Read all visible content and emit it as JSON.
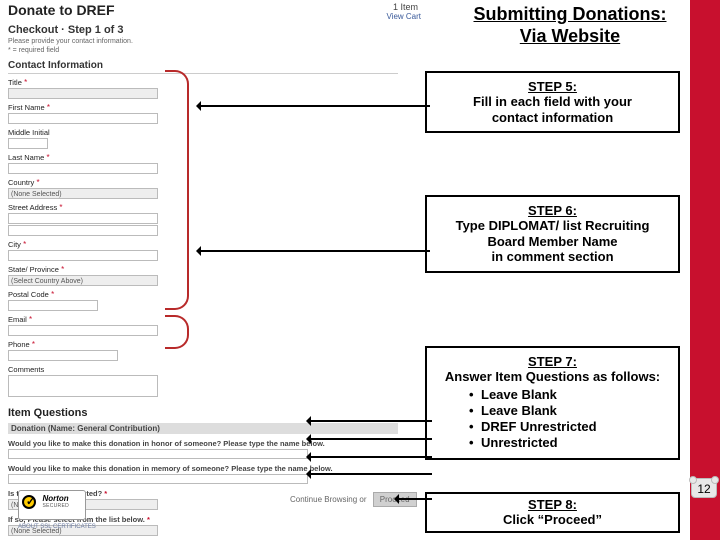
{
  "slide": {
    "title_l1": "Submitting Donations:",
    "title_l2": "Via Website",
    "page_number": "12"
  },
  "checkout": {
    "header": "Donate to DREF",
    "item_count": "1 Item",
    "view_cart": "View Cart",
    "step_line": "Checkout · Step 1 of 3",
    "step_note": "Please provide your contact information.",
    "req_note": "* = required field",
    "section_header": "Contact Information",
    "fields": {
      "title": "Title",
      "title_value": "",
      "first_name": "First Name",
      "middle_initial": "Middle Initial",
      "last_name": "Last Name",
      "country": "Country",
      "country_value": "(None Selected)",
      "street_address": "Street Address",
      "city": "City",
      "state": "State/ Province",
      "state_value": "(Select Country Above)",
      "postal": "Postal Code",
      "email": "Email",
      "phone": "Phone",
      "comments": "Comments"
    },
    "item_questions_header": "Item Questions",
    "donation_bar": "Donation (Name: General Contribution)",
    "q1": "Would you like to make this donation in honor of someone? Please type the name below.",
    "q2": "Would you like to make this donation in memory of someone? Please type the name below.",
    "q3": "Is the donation restricted?",
    "q3_value": "(None Selected)",
    "q4": "If so, Please select from the list below.",
    "q4_value": "(None Selected)",
    "continue_browsing": "Continue Browsing",
    "or": "or",
    "proceed": "Proceed",
    "norton_name": "Norton",
    "norton_sub": "SECURED",
    "about_ssl": "ABOUT SSL CERTIFICATES"
  },
  "callouts": {
    "c5": {
      "label": "STEP 5:",
      "body_l1": "Fill in each field with your",
      "body_l2": "contact information"
    },
    "c6": {
      "label": "STEP 6:",
      "body_l1": "Type DIPLOMAT/ list Recruiting",
      "body_l2": "Board Member Name",
      "body_l3": "in comment section"
    },
    "c7": {
      "label": "STEP 7:",
      "body": "Answer Item Questions as follows:",
      "items": [
        "Leave Blank",
        "Leave Blank",
        "DREF Unrestricted",
        "Unrestricted"
      ]
    },
    "c8": {
      "label": "STEP 8:",
      "body": "Click “Proceed”"
    }
  }
}
